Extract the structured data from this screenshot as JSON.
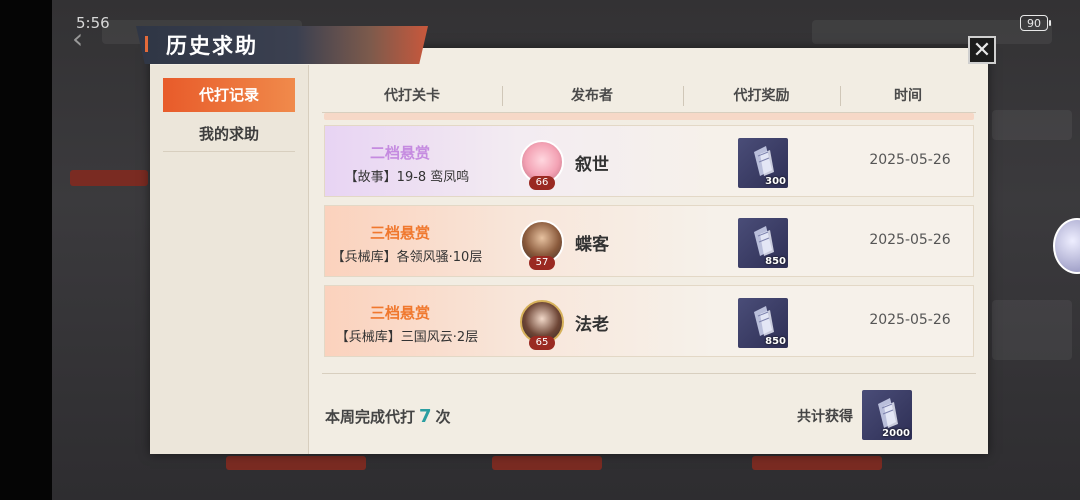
{
  "status": {
    "time": "5:56",
    "battery": "90"
  },
  "dialog": {
    "title": "历史求助",
    "close_symbol": "✕"
  },
  "sidebar": {
    "tabs": [
      {
        "label": "代打记录",
        "active": true
      },
      {
        "label": "我的求助",
        "active": false
      }
    ]
  },
  "table": {
    "headers": [
      "代打关卡",
      "发布者",
      "代打奖励",
      "时间"
    ],
    "rows": [
      {
        "tier": "二档悬赏",
        "tier_color": "#c58be0",
        "stage": "【故事】19-8 鸾凤鸣",
        "publisher": "叙世",
        "level": "66",
        "reward_qty": "300",
        "time": "2025-05-26",
        "row_gradient": "purple"
      },
      {
        "tier": "三档悬赏",
        "tier_color": "#f0782e",
        "stage": "【兵械库】各领风骚·10层",
        "publisher": "蝶客",
        "level": "57",
        "reward_qty": "850",
        "time": "2025-05-26",
        "row_gradient": "orange"
      },
      {
        "tier": "三档悬赏",
        "tier_color": "#f0782e",
        "stage": "【兵械库】三国风云·2层",
        "publisher": "法老",
        "level": "65",
        "reward_qty": "850",
        "time": "2025-05-26",
        "row_gradient": "orange"
      }
    ]
  },
  "footer": {
    "completed_prefix": "本周完成代打",
    "completed_count": "7",
    "completed_suffix": "次",
    "total_label": "共计获得",
    "total_qty": "2000"
  },
  "colors": {
    "accent": "#e85b2a",
    "panel": "#f2ede3",
    "count": "#2a9ea1"
  }
}
